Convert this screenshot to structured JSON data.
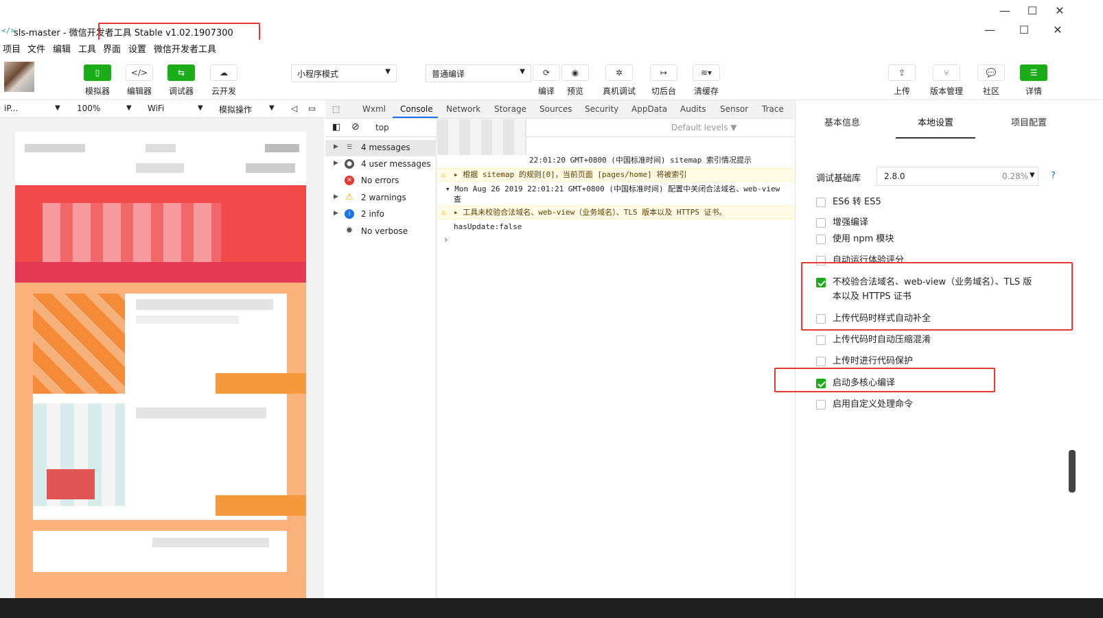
{
  "window": {
    "title": "sls-master - 微信开发者工具 Stable v1.02.1907300",
    "controls": [
      "—",
      "☐",
      "✕"
    ]
  },
  "menu": [
    "项目",
    "文件",
    "编辑",
    "工具",
    "界面",
    "设置",
    "微信开发者工具"
  ],
  "toolbar": {
    "left": [
      {
        "label": "模拟器",
        "icon": "phone-icon"
      },
      {
        "label": "编辑器",
        "icon": "code-icon"
      },
      {
        "label": "调试器",
        "icon": "debug-icon"
      },
      {
        "label": "云开发",
        "icon": "cloud-icon"
      }
    ],
    "mode_select": "小程序模式",
    "compile_select": "普通编译",
    "middle": [
      {
        "label": "编译",
        "icon": "refresh-icon"
      },
      {
        "label": "预览",
        "icon": "eye-icon"
      },
      {
        "label": "真机调试",
        "icon": "bug-icon"
      },
      {
        "label": "切后台",
        "icon": "switch-icon"
      },
      {
        "label": "清缓存",
        "icon": "layers-icon"
      }
    ],
    "right": [
      {
        "label": "上传",
        "icon": "upload-icon"
      },
      {
        "label": "版本管理",
        "icon": "branch-icon"
      },
      {
        "label": "社区",
        "icon": "chat-icon"
      },
      {
        "label": "详情",
        "icon": "menu-icon"
      }
    ]
  },
  "simbar": {
    "device": "iP...",
    "zoom": "100%",
    "network": "WiFi",
    "ops": "模拟操作"
  },
  "devtools": {
    "tabs": [
      "Wxml",
      "Console",
      "Network",
      "Storage",
      "Sources",
      "Security",
      "AppData",
      "Audits",
      "Sensor",
      "Trace"
    ],
    "active_tab": "Console",
    "context": "top",
    "levels": "Default levels ▼",
    "sidebar": [
      {
        "label": "4 messages",
        "icon": "list-icon",
        "color": "#555555",
        "arrow": true
      },
      {
        "label": "4 user messages",
        "icon": "user-icon",
        "color": "#555555",
        "arrow": true
      },
      {
        "label": "No errors",
        "icon": "error-icon",
        "color": "#e53935",
        "arrow": false
      },
      {
        "label": "2 warnings",
        "icon": "warning-icon",
        "color": "#f2a600",
        "arrow": true
      },
      {
        "label": "2 info",
        "icon": "info-icon",
        "color": "#1a73e8",
        "arrow": true
      },
      {
        "label": "No verbose",
        "icon": "gear-icon",
        "color": "#555555",
        "arrow": false
      }
    ],
    "console_lines": [
      {
        "text": "22:01:20 GMT+0800 (中国标准时间) sitemap 索引情况提示",
        "kind": "log"
      },
      {
        "text": "▸ 根据 sitemap 的规则[0]，当前页面 [pages/home] 将被索引",
        "kind": "warn"
      },
      {
        "text": "▾ Mon Aug 26 2019 22:01:21 GMT+0800 (中国标准时间) 配置中关闭合法域名、web-view",
        "kind": "log"
      },
      {
        "text": "查",
        "kind": "log"
      },
      {
        "text": "▸ 工具未校验合法域名、web-view（业务域名）、TLS 版本以及 HTTPS 证书。",
        "kind": "warn"
      },
      {
        "text": "hasUpdate:false",
        "kind": "log"
      }
    ],
    "prompt": "›"
  },
  "details": {
    "tabs": [
      "基本信息",
      "本地设置",
      "项目配置"
    ],
    "active_tab": "本地设置",
    "lib_label": "调试基础库",
    "lib_version": "2.8.0",
    "lib_usage": "0.28%",
    "help": "?",
    "options": [
      {
        "label": "ES6 转 ES5",
        "checked": false
      },
      {
        "label": "增强编译",
        "checked": false
      },
      {
        "label": "使用 npm 模块",
        "checked": false
      },
      {
        "label": "自动运行体验评分",
        "checked": false
      },
      {
        "label": "不校验合法域名、web-view（业务域名）、TLS 版",
        "label2": "本以及 HTTPS 证书",
        "checked": true
      },
      {
        "label": "上传代码时样式自动补全",
        "checked": false
      },
      {
        "label": "上传代码时自动压缩混淆",
        "checked": false
      },
      {
        "label": "上传时进行代码保护",
        "checked": false
      },
      {
        "label": "启动多核心编译",
        "checked": true
      },
      {
        "label": "启用自定义处理命令",
        "checked": false
      }
    ]
  },
  "colors": {
    "accent_green": "#1aad19",
    "highlight_red": "#e53935",
    "link_blue": "#1a73e8"
  }
}
